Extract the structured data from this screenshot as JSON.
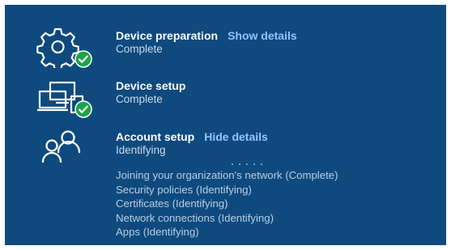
{
  "steps": [
    {
      "title": "Device preparation",
      "link": "Show details",
      "status": "Complete",
      "icon": "gear-icon",
      "badge": "check-badge-icon"
    },
    {
      "title": "Device setup",
      "link": "",
      "status": "Complete",
      "icon": "devices-icon",
      "badge": "check-badge-icon"
    },
    {
      "title": "Account setup",
      "link": "Hide details",
      "status": "Identifying",
      "icon": "people-icon",
      "details": [
        "Joining your organization's network (Complete)",
        "Security policies (Identifying)",
        "Certificates (Identifying)",
        "Network connections (Identifying)",
        "Apps (Identifying)"
      ]
    }
  ],
  "colors": {
    "background": "#0e4a7e",
    "link": "#8cc7ff",
    "check": "#1fa14a"
  }
}
